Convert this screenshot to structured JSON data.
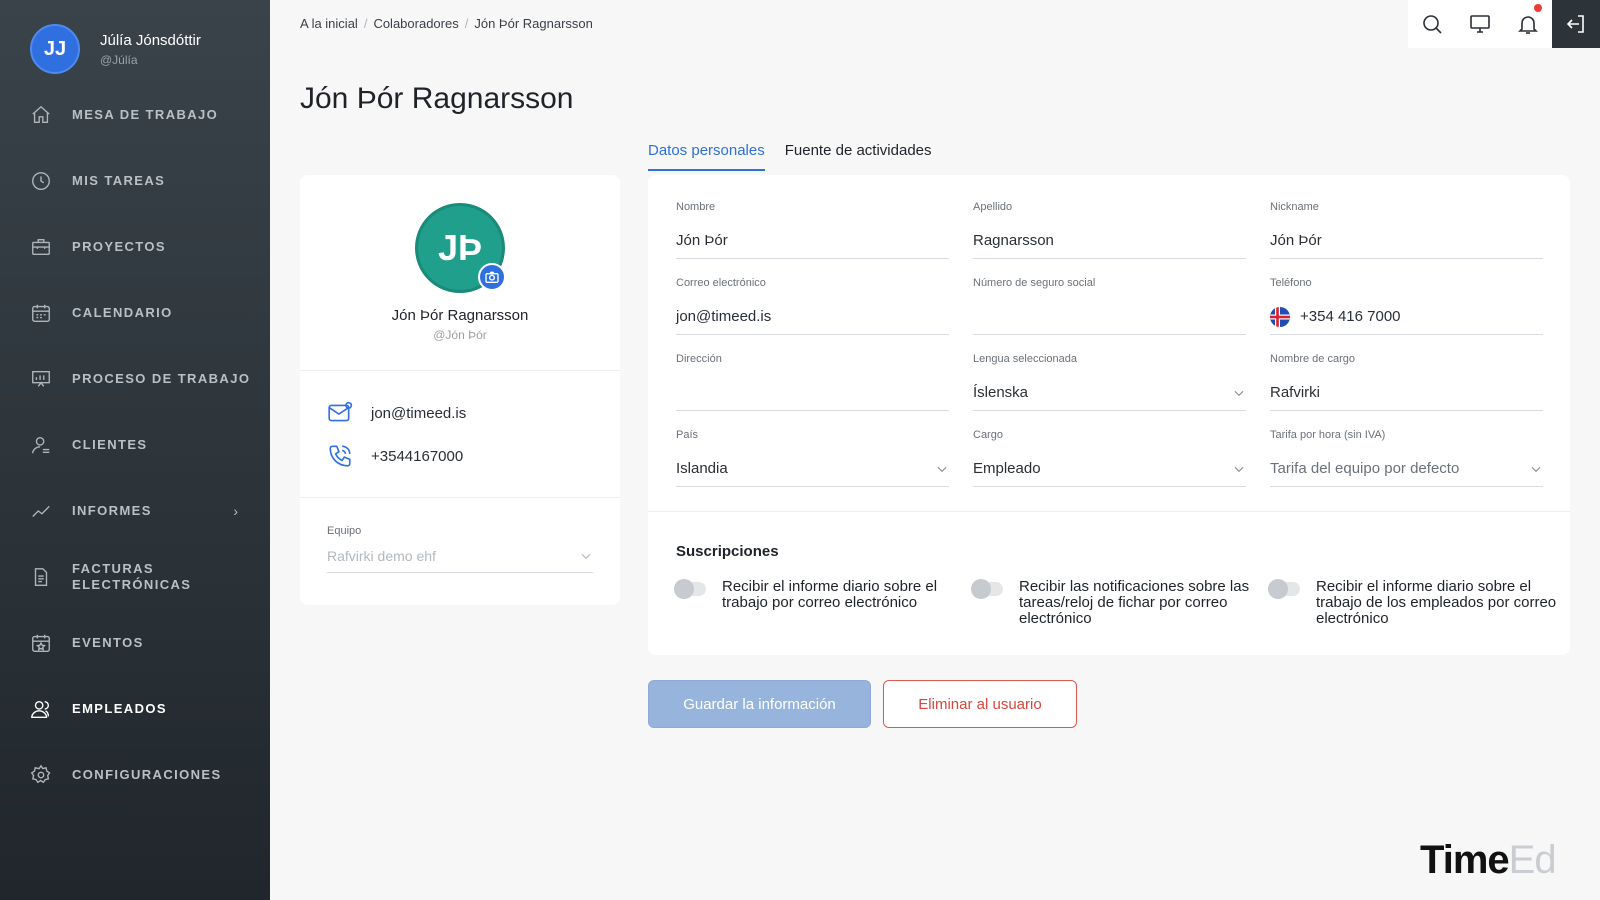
{
  "sidebar": {
    "user": {
      "initials": "JJ",
      "name": "Júlía Jónsdóttir",
      "handle": "@Júlía"
    },
    "items": [
      {
        "label": "MESA DE TRABAJO",
        "icon": "home-icon"
      },
      {
        "label": "MIS TAREAS",
        "icon": "clock-icon"
      },
      {
        "label": "PROYECTOS",
        "icon": "briefcase-icon"
      },
      {
        "label": "CALENDARIO",
        "icon": "calendar-icon"
      },
      {
        "label": "PROCESO DE TRABAJO",
        "icon": "presentation-icon"
      },
      {
        "label": "CLIENTES",
        "icon": "user-icon"
      },
      {
        "label": "INFORMES",
        "icon": "trend-icon"
      },
      {
        "label": "FACTURAS ELECTRÓNICAS",
        "icon": "document-icon"
      },
      {
        "label": "EVENTOS",
        "icon": "calendar-star-icon"
      },
      {
        "label": "EMPLEADOS",
        "icon": "users-icon"
      },
      {
        "label": "CONFIGURACIONES",
        "icon": "gear-icon"
      }
    ],
    "active": "EMPLEADOS",
    "accent": "#2f6fe0"
  },
  "breadcrumb": [
    "A la inicial",
    "Colaboradores",
    "Jón Þór Ragnarsson"
  ],
  "page_title": "Jón Þór Ragnarsson",
  "profile": {
    "initials": "JÞ",
    "name": "Jón Þór Ragnarsson",
    "handle": "@Jón Þór",
    "email": "jon@timeed.is",
    "phone": "+3544167000",
    "team_label": "Equipo",
    "team_value": "Rafvirki demo ehf"
  },
  "tabs": [
    "Datos personales",
    "Fuente de actividades"
  ],
  "form": {
    "nombre": {
      "label": "Nombre",
      "value": "Jón Þór"
    },
    "apellido": {
      "label": "Apellido",
      "value": "Ragnarsson"
    },
    "nickname": {
      "label": "Nickname",
      "value": "Jón Þór"
    },
    "correo": {
      "label": "Correo electrónico",
      "value": "jon@timeed.is"
    },
    "seguro": {
      "label": "Número de seguro social",
      "value": ""
    },
    "telefono": {
      "label": "Teléfono",
      "value": "+354 416 7000"
    },
    "direccion": {
      "label": "Dirección",
      "value": ""
    },
    "lengua": {
      "label": "Lengua seleccionada",
      "value": "Íslenska"
    },
    "cargo_nombre": {
      "label": "Nombre de cargo",
      "value": "Rafvirki"
    },
    "pais": {
      "label": "País",
      "value": "Islandia"
    },
    "cargo": {
      "label": "Cargo",
      "value": "Empleado"
    },
    "tarifa": {
      "label": "Tarifa por hora (sin IVA)",
      "value": "Tarifa del equipo por defecto"
    }
  },
  "subscriptions": {
    "title": "Suscripciones",
    "items": [
      "Recibir el informe diario sobre el trabajo por correo electrónico",
      "Recibir las notificaciones sobre las tareas/reloj de fichar por correo electrónico",
      "Recibir el informe diario sobre el trabajo de los empleados por correo electrónico"
    ]
  },
  "buttons": {
    "save": "Guardar la información",
    "delete": "Eliminar al usuario"
  },
  "logo": {
    "main": "Time",
    "accent": "Ed"
  }
}
